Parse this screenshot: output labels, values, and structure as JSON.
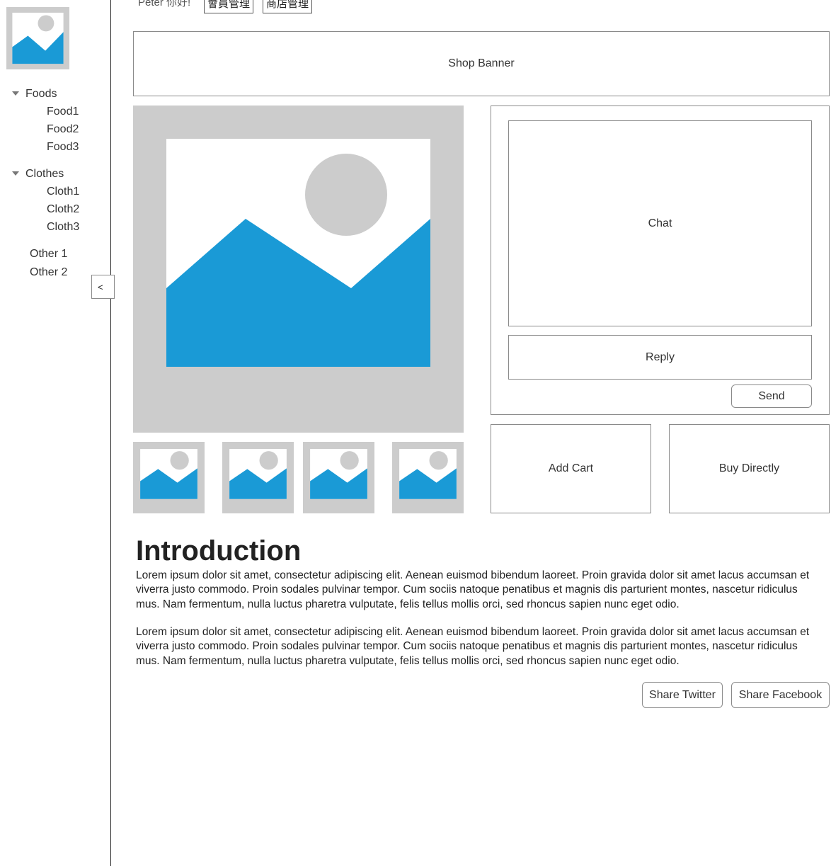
{
  "header": {
    "greeting": "Peter 你好!",
    "buttons": [
      "會員管理",
      "商店管理"
    ]
  },
  "sidebar": {
    "categories": [
      {
        "label": "Foods",
        "items": [
          "Food1",
          "Food2",
          "Food3"
        ]
      },
      {
        "label": "Clothes",
        "items": [
          "Cloth1",
          "Cloth2",
          "Cloth3"
        ]
      }
    ],
    "others": [
      "Other 1",
      "Other 2"
    ],
    "collapse_label": "<"
  },
  "banner": {
    "label": "Shop Banner"
  },
  "chat": {
    "panel_label": "Chat",
    "reply_label": "Reply",
    "send_label": "Send"
  },
  "actions": {
    "add_cart": "Add Cart",
    "buy_directly": "Buy Directly"
  },
  "intro": {
    "title": "Introduction",
    "paragraphs": [
      "Lorem ipsum dolor sit amet, consectetur adipiscing elit. Aenean euismod bibendum laoreet. Proin gravida dolor sit amet lacus accumsan et viverra justo commodo. Proin sodales pulvinar tempor. Cum sociis natoque penatibus et magnis dis parturient montes, nascetur ridiculus mus. Nam fermentum, nulla luctus pharetra vulputate, felis tellus mollis orci, sed rhoncus sapien nunc eget odio.",
      "Lorem ipsum dolor sit amet, consectetur adipiscing elit. Aenean euismod bibendum laoreet. Proin gravida dolor sit amet lacus accumsan et viverra justo commodo. Proin sodales pulvinar tempor. Cum sociis natoque penatibus et magnis dis parturient montes, nascetur ridiculus mus. Nam fermentum, nulla luctus pharetra vulputate, felis tellus mollis orci, sed rhoncus sapien nunc eget odio."
    ]
  },
  "share": {
    "twitter": "Share Twitter",
    "facebook": "Share Facebook"
  },
  "colors": {
    "placeholder_bg": "#cccccc",
    "image_blue": "#1a9ad6",
    "image_sun": "#cccccc"
  }
}
